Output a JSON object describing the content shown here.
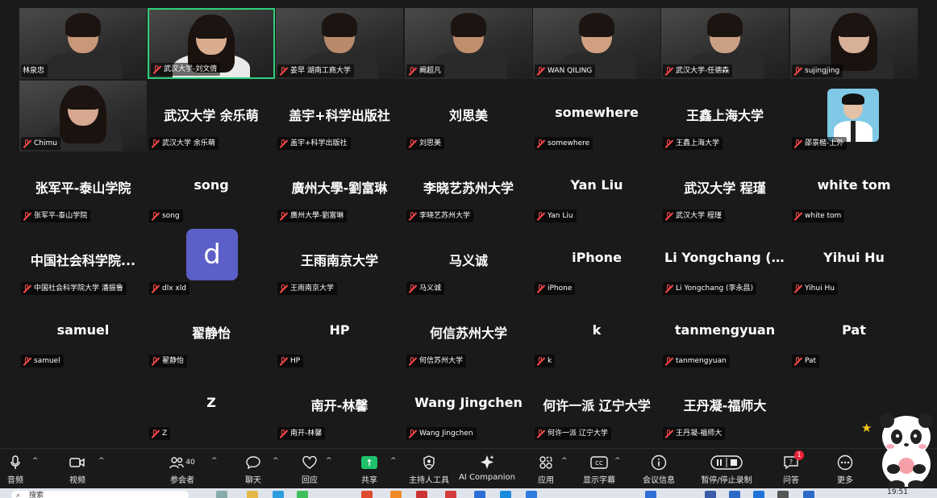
{
  "tiles": [
    {
      "name": "林泉忠"
    },
    {
      "name": "武汉大学-刘文倩"
    },
    {
      "name": "姜早 湖南工商大学"
    },
    {
      "name": "阚超凡"
    },
    {
      "name": "WAN QILING"
    },
    {
      "name": "武汉大学-任德森"
    },
    {
      "name": "sujingjing"
    },
    {
      "name": "Chimu"
    },
    {
      "display": "武汉大学 余乐萌",
      "name": "武汉大学 余乐萌"
    },
    {
      "display": "盖宇+科学出版社",
      "name": "盖宇+科学出版社"
    },
    {
      "display": "刘思美",
      "name": "刘思美"
    },
    {
      "display": "somewhere",
      "name": "somewhere"
    },
    {
      "display": "王鑫上海大学",
      "name": "王鑫上海大学"
    },
    {
      "name": "邵景楷-上外"
    },
    {
      "display": "张军平-泰山学院",
      "name": "张军平-泰山学院"
    },
    {
      "display": "song",
      "name": "song"
    },
    {
      "display": "廣州大學-劉富琳",
      "name": "廣州大學-劉富琳"
    },
    {
      "display": "李晓艺苏州大学",
      "name": "李晓艺苏州大学"
    },
    {
      "display": "Yan Liu",
      "name": "Yan Liu"
    },
    {
      "display": "武汉大学 程瑾",
      "name": "武汉大学 程瑾"
    },
    {
      "display": "white tom",
      "name": "white tom"
    },
    {
      "display": "中国社会科学院...",
      "name": "中国社会科学院大学 潘振鲁"
    },
    {
      "avatar_letter": "d",
      "name": "dlx xld"
    },
    {
      "display": "王雨南京大学",
      "name": "王雨南京大学"
    },
    {
      "display": "马义诚",
      "name": "马义诚"
    },
    {
      "display": "iPhone",
      "name": "iPhone"
    },
    {
      "display": "Li Yongchang (...",
      "name": "Li Yongchang (李永昌)"
    },
    {
      "display": "Yihui Hu",
      "name": "Yihui Hu"
    },
    {
      "display": "samuel",
      "name": "samuel"
    },
    {
      "display": "翟静怡",
      "name": "翟静怡"
    },
    {
      "display": "HP",
      "name": "HP"
    },
    {
      "display": "何信苏州大学",
      "name": "何信苏州大学"
    },
    {
      "display": "k",
      "name": "k"
    },
    {
      "display": "tanmengyuan",
      "name": "tanmengyuan"
    },
    {
      "display": "Pat",
      "name": "Pat"
    },
    {
      "display": "Z",
      "name": "Z"
    },
    {
      "display": "南开-林馨",
      "name": "南开-林馨"
    },
    {
      "display": "Wang Jingchen",
      "name": "Wang Jingchen"
    },
    {
      "display": "何许一派 辽宁大学",
      "name": "何许一派 辽宁大学"
    },
    {
      "display": "王丹凝-福师大",
      "name": "王丹凝-福师大"
    }
  ],
  "toolbar": {
    "audio": "音频",
    "video": "视频",
    "participants": "参会者",
    "participants_count": "40",
    "chat": "聊天",
    "react": "回应",
    "share": "共享",
    "host_tools": "主持人工具",
    "ai_companion": "AI Companion",
    "apps": "应用",
    "captions": "显示字幕",
    "meeting_info": "会议信息",
    "record": "暂停/停止录制",
    "qa": "问答",
    "qa_badge": "1",
    "more": "更多"
  },
  "taskbar": {
    "search_placeholder": "搜索",
    "time": "19:51"
  },
  "colors": {
    "active_speaker": "#2fd07a",
    "mic_off": "#ff4a4a",
    "share": "#1fc16b",
    "avatar": "#5b5fc7"
  }
}
